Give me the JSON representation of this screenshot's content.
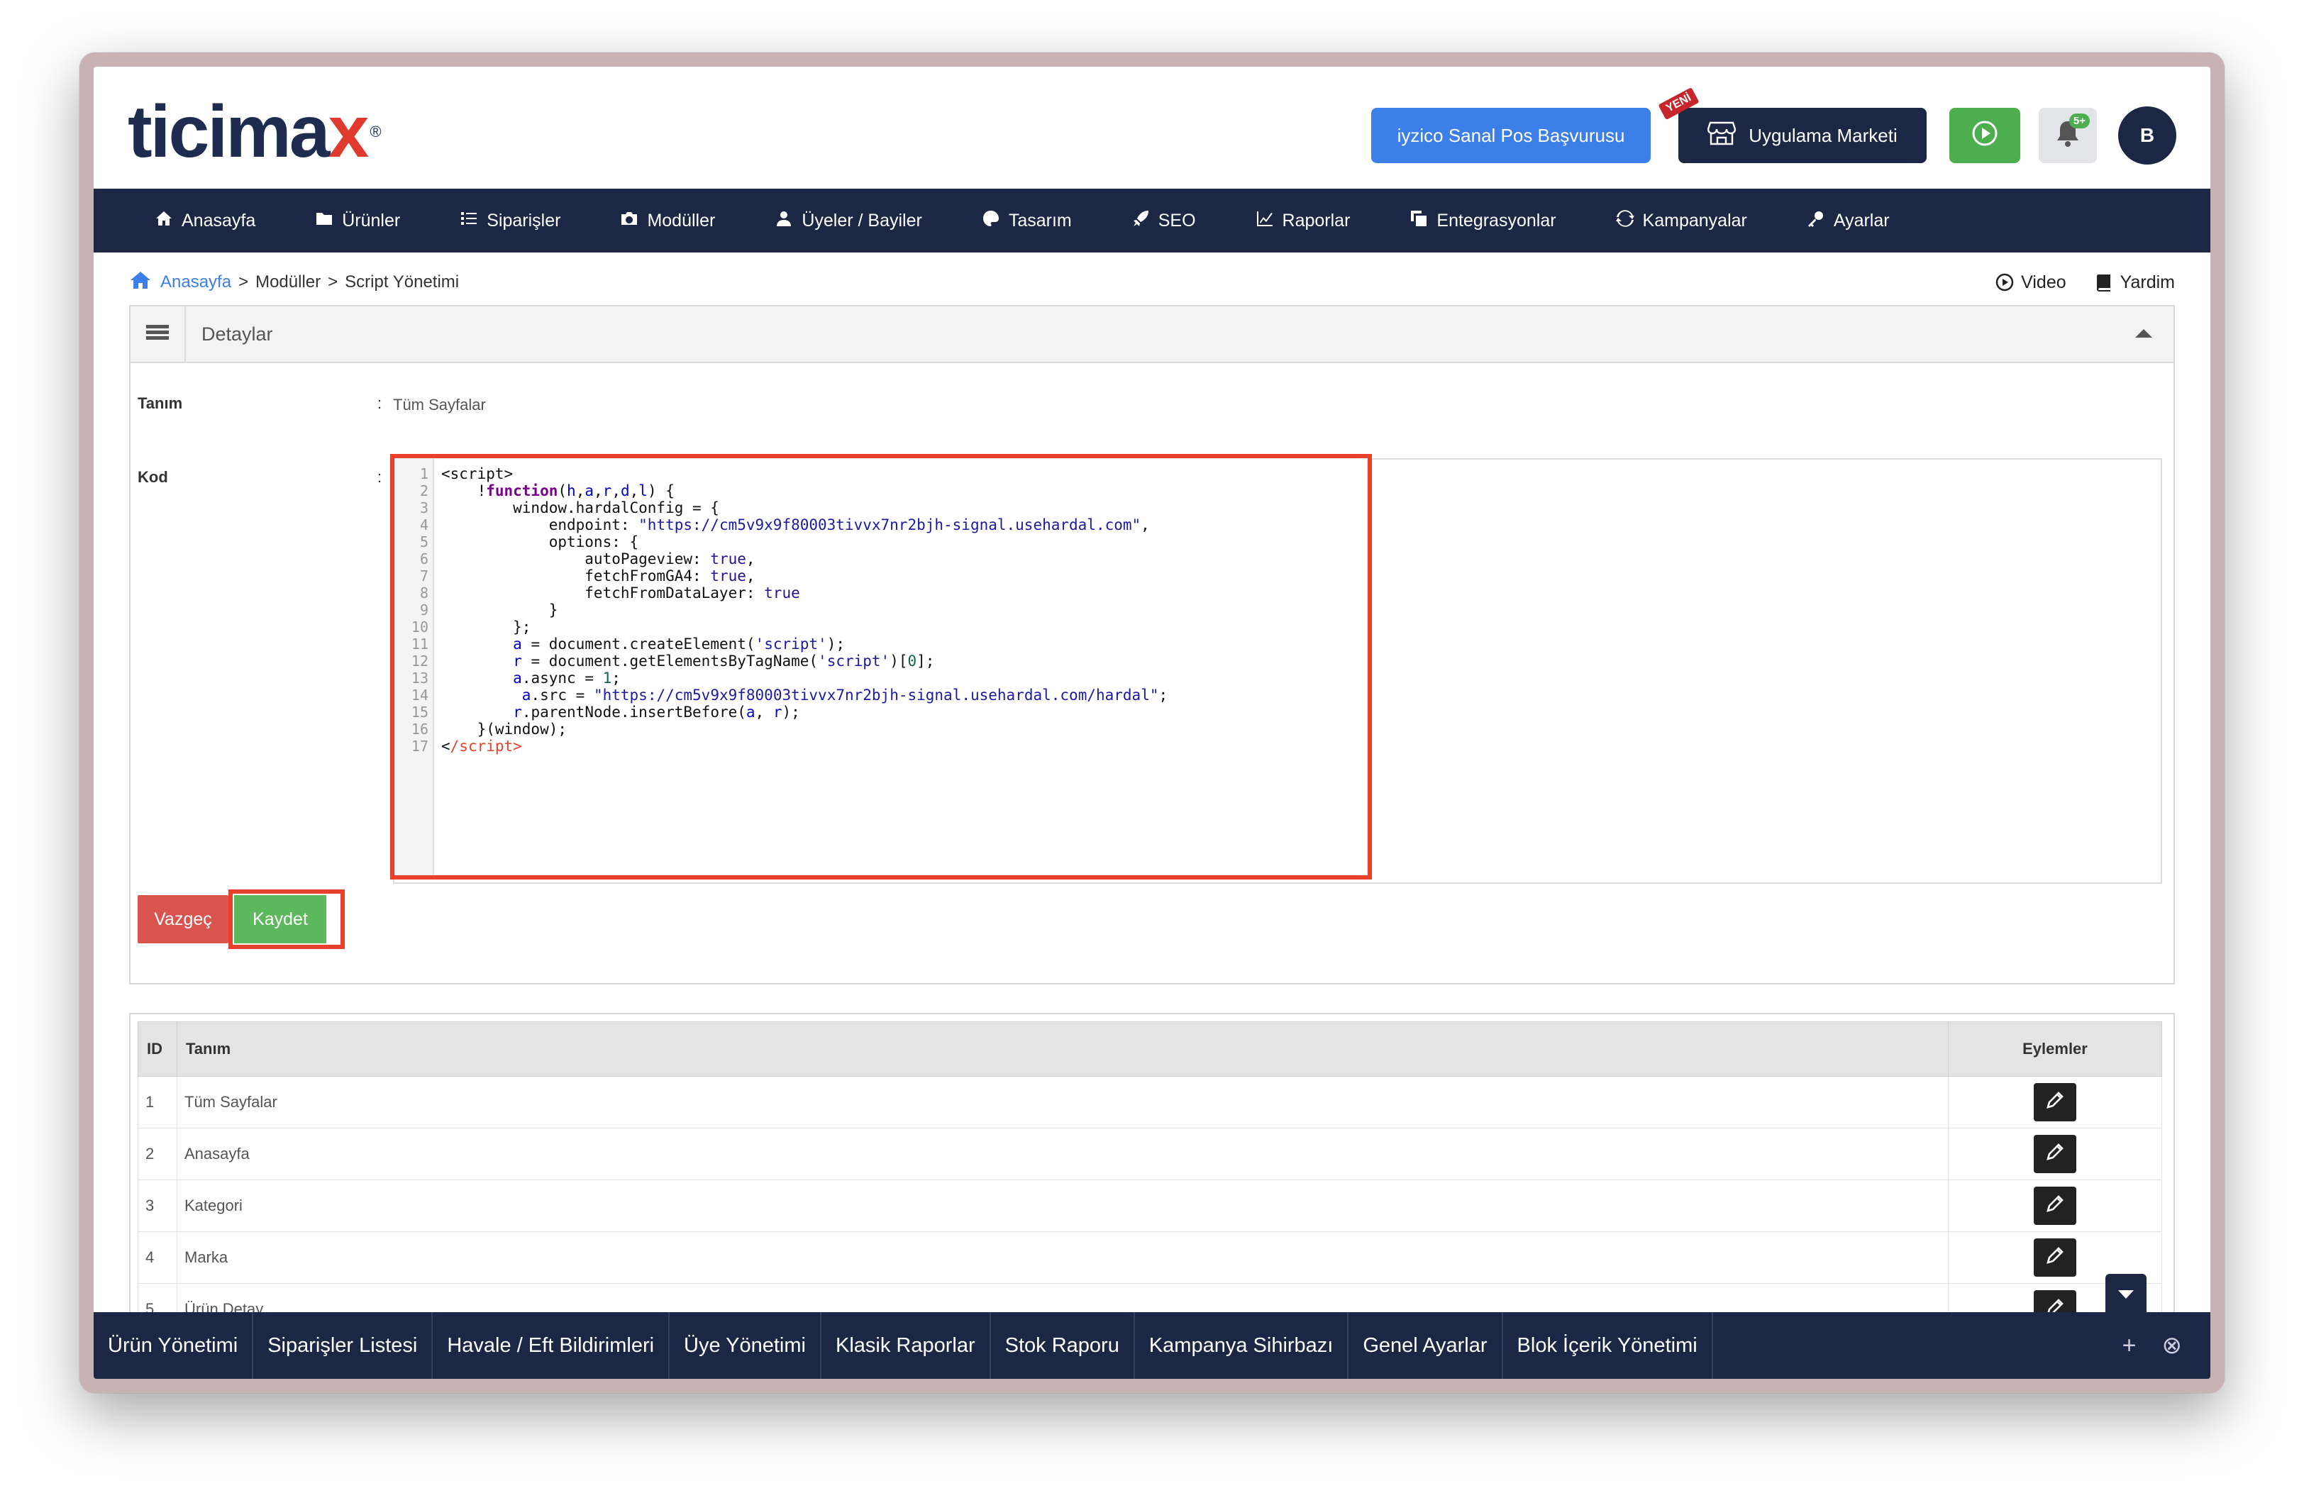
{
  "header": {
    "logo_text": "ticima",
    "logo_x": "x",
    "logo_reg": "®",
    "iyzico_label": "iyzico Sanal Pos Başvurusu",
    "market_label": "Uygulama Marketi",
    "market_badge": "YENİ",
    "bell_badge": "5+",
    "avatar_initial": "B"
  },
  "nav": {
    "items": [
      {
        "label": "Anasayfa",
        "icon": "home-icon"
      },
      {
        "label": "Ürünler",
        "icon": "folder-icon"
      },
      {
        "label": "Siparişler",
        "icon": "list-icon"
      },
      {
        "label": "Modüller",
        "icon": "camera-icon"
      },
      {
        "label": "Üyeler / Bayiler",
        "icon": "users-icon"
      },
      {
        "label": "Tasarım",
        "icon": "palette-icon"
      },
      {
        "label": "SEO",
        "icon": "rocket-icon"
      },
      {
        "label": "Raporlar",
        "icon": "chart-icon"
      },
      {
        "label": "Entegrasyonlar",
        "icon": "copy-icon"
      },
      {
        "label": "Kampanyalar",
        "icon": "refresh-icon"
      },
      {
        "label": "Ayarlar",
        "icon": "key-icon"
      }
    ]
  },
  "breadcrumb": {
    "home": "Anasayfa",
    "sep1": ">",
    "modules": "Modüller",
    "sep2": ">",
    "current": "Script Yönetimi"
  },
  "topright": {
    "video": "Video",
    "help": "Yardim"
  },
  "panel": {
    "title": "Detaylar",
    "tanim_label": "Tanım",
    "colon": ":",
    "tanim_value": "Tüm Sayfalar",
    "kod_label": "Kod",
    "line_numbers": [
      "1",
      "2",
      "3",
      "4",
      "5",
      "6",
      "7",
      "8",
      "9",
      "10",
      "11",
      "12",
      "13",
      "14",
      "15",
      "16",
      "17"
    ],
    "cancel_label": "Vazgeç",
    "save_label": "Kaydet"
  },
  "table": {
    "headers": {
      "id": "ID",
      "tanim": "Tanım",
      "actions": "Eylemler"
    },
    "rows": [
      {
        "id": "1",
        "tanim": "Tüm Sayfalar"
      },
      {
        "id": "2",
        "tanim": "Anasayfa"
      },
      {
        "id": "3",
        "tanim": "Kategori"
      },
      {
        "id": "4",
        "tanim": "Marka"
      },
      {
        "id": "5",
        "tanim": "Ürün Detay"
      }
    ]
  },
  "bottombar": {
    "items": [
      "Ürün Yönetimi",
      "Siparişler Listesi",
      "Havale / Eft Bildirimleri",
      "Üye Yönetimi",
      "Klasik Raporlar",
      "Stok Raporu",
      "Kampanya Sihirbazı",
      "Genel Ayarlar",
      "Blok İçerik Yönetimi"
    ],
    "add": "+",
    "close": "⊗"
  },
  "colors": {
    "navy": "#1b2744",
    "blue": "#3d7fe8",
    "green": "#4cae4f",
    "red": "#d9534f",
    "highlight": "#e8402c"
  }
}
